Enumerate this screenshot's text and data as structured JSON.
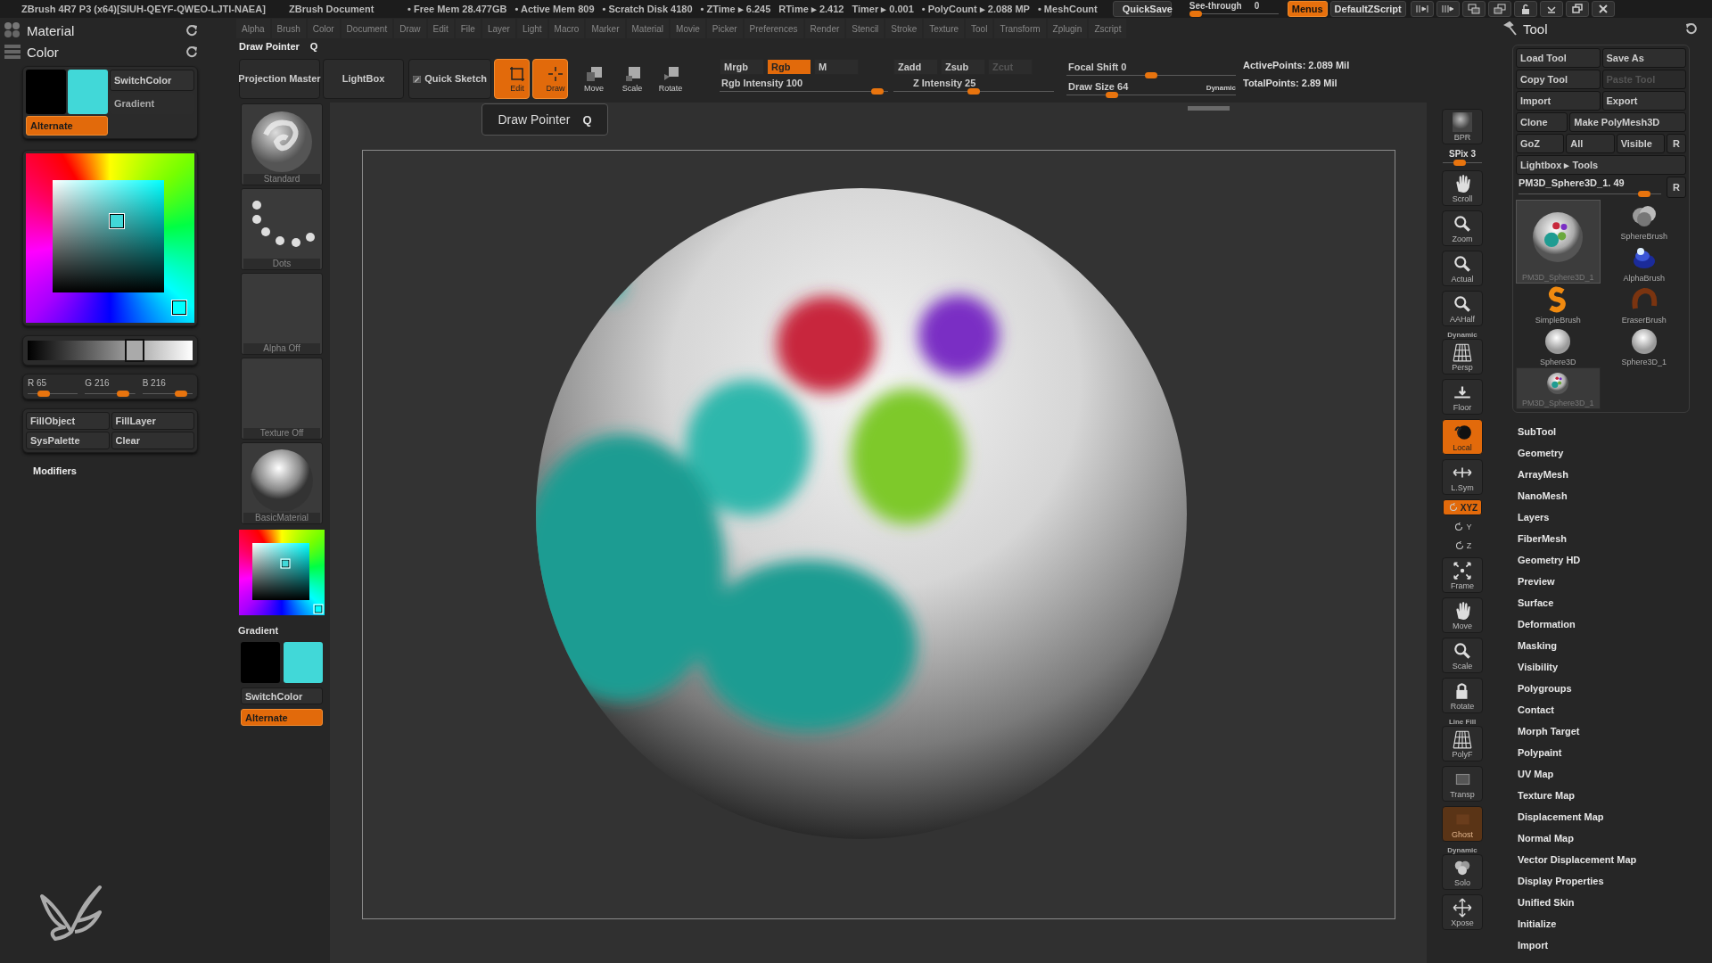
{
  "title_bar": {
    "app_title": "ZBrush 4R7 P3 (x64)[SIUH-QEYF-QWEO-LJTI-NAEA]",
    "document": "ZBrush Document",
    "stats": [
      "• Free Mem 28.477GB",
      "• Active Mem 809",
      "• Scratch Disk 4180",
      "• ZTime ▸ 6.245",
      "RTime ▸ 2.412",
      "Timer ▸ 0.001",
      "• PolyCount ▸ 2.088 MP",
      "• MeshCount"
    ],
    "quicksave": "QuickSave",
    "see_through": {
      "label": "See-through",
      "value": "0",
      "level": 0
    },
    "menus": {
      "label": "Menus",
      "on": true
    },
    "script": "DefaultZScript"
  },
  "menu_bar": [
    "Alpha",
    "Brush",
    "Color",
    "Document",
    "Draw",
    "Edit",
    "File",
    "Layer",
    "Light",
    "Macro",
    "Marker",
    "Material",
    "Movie",
    "Picker",
    "Preferences",
    "Render",
    "Stencil",
    "Stroke",
    "Texture",
    "Tool",
    "Transform",
    "Zplugin",
    "Zscript"
  ],
  "left_panel": {
    "palettes": [
      {
        "title": "Material",
        "kind": "material"
      },
      {
        "title": "Color",
        "kind": "color"
      }
    ],
    "swatches": [
      {
        "color": "#000000"
      },
      {
        "color": "#41d8d8"
      }
    ],
    "switch_color": "SwitchColor",
    "gradient": "Gradient",
    "alternate": {
      "label": "Alternate",
      "on": true
    },
    "shade": {
      "level": 0.65
    },
    "channels": [
      {
        "label": "R 65",
        "level": 0.25
      },
      {
        "label": "G 216",
        "level": 0.85
      },
      {
        "label": "B 216",
        "level": 0.85
      }
    ],
    "fill_buttons": [
      "FillObject",
      "FillLayer",
      "SysPalette",
      "Clear"
    ],
    "modifiers": "Modifiers"
  },
  "shelf": {
    "title": "Draw Pointer",
    "hotkey": "Q",
    "buttons": [
      {
        "label": "Projection Master",
        "kind": "text",
        "on": false
      },
      {
        "label": "LightBox",
        "kind": "text",
        "on": false
      },
      {
        "label": "Quick Sketch",
        "kind": "sketch",
        "on": false
      },
      {
        "label": "Edit",
        "kind": "edit",
        "on": true
      },
      {
        "label": "Draw",
        "kind": "draw",
        "on": true
      },
      {
        "label": "Move",
        "kind": "move",
        "on": false
      },
      {
        "label": "Scale",
        "kind": "scale",
        "on": false
      },
      {
        "label": "Rotate",
        "kind": "rotate",
        "on": false
      }
    ],
    "color_modes": [
      {
        "label": "Mrgb",
        "on": false
      },
      {
        "label": "Rgb",
        "on": true
      },
      {
        "label": "M",
        "on": false
      }
    ],
    "rgb_intensity": {
      "label": "Rgb Intensity 100",
      "level": 0.97
    },
    "depth_modes": [
      {
        "label": "Zadd",
        "on": false,
        "disabled": false
      },
      {
        "label": "Zsub",
        "on": false,
        "disabled": false
      },
      {
        "label": "Zcut",
        "on": false,
        "disabled": true
      }
    ],
    "z_intensity": {
      "label": "Z Intensity 25",
      "level": 0.5
    },
    "focal_shift": {
      "label": "Focal Shift 0",
      "level": 0.5
    },
    "draw_size": {
      "label": "Draw Size 64",
      "level": 0.25
    },
    "dynamic": "Dynamic",
    "points": [
      "ActivePoints: 2.089 Mil",
      "TotalPoints: 2.89 Mil"
    ]
  },
  "shelf_column": {
    "thumbnails": [
      {
        "label": "Standard",
        "kind": "brush"
      },
      {
        "label": "Dots",
        "kind": "stroke"
      },
      {
        "label": "Alpha Off",
        "kind": "alpha"
      },
      {
        "label": "Texture Off",
        "kind": "texture"
      },
      {
        "label": "BasicMaterial",
        "kind": "material"
      }
    ],
    "gradient": "Gradient",
    "swatches": [
      {
        "color": "#000000"
      },
      {
        "color": "#41d8d8"
      }
    ],
    "switch_color": "SwitchColor",
    "alternate": {
      "label": "Alternate",
      "on": true
    }
  },
  "tooltip": {
    "label": "Draw Pointer",
    "hotkey": "Q"
  },
  "right_toolbar": [
    {
      "label": "BPR",
      "kind": "button",
      "on": false
    },
    {
      "label": "SPix 3",
      "kind": "slider",
      "level": 0.4
    },
    {
      "label": "Scroll",
      "kind": "button",
      "on": false
    },
    {
      "label": "Zoom",
      "kind": "button",
      "on": false
    },
    {
      "label": "Actual",
      "kind": "button",
      "on": false
    },
    {
      "label": "AAHalf",
      "kind": "button",
      "on": false
    },
    {
      "label": "Persp",
      "caption": "Dynamic",
      "kind": "button",
      "on": false
    },
    {
      "label": "Floor",
      "kind": "button",
      "on": false
    },
    {
      "label": "Local",
      "kind": "button",
      "on": true
    },
    {
      "label": "L.Sym",
      "kind": "button",
      "on": false
    },
    {
      "label": "XYZ",
      "kind": "toggle",
      "on": true
    },
    {
      "label": "Y",
      "kind": "mini"
    },
    {
      "label": "Z",
      "kind": "mini"
    },
    {
      "label": "Frame",
      "kind": "button",
      "on": false
    },
    {
      "label": "Move",
      "kind": "button",
      "on": false
    },
    {
      "label": "Scale",
      "kind": "button",
      "on": false
    },
    {
      "label": "Rotate",
      "kind": "button",
      "on": false
    },
    {
      "label": "PolyF",
      "caption": "Line Fill",
      "kind": "button",
      "on": false
    },
    {
      "label": "Transp",
      "kind": "button",
      "on": false
    },
    {
      "label": "Ghost",
      "kind": "button",
      "disabled": true
    },
    {
      "label": "Solo",
      "caption": "Dynamic",
      "kind": "button",
      "on": false
    },
    {
      "label": "Xpose",
      "kind": "button",
      "on": false
    }
  ],
  "tool_panel": {
    "title": "Tool",
    "rows": [
      [
        {
          "label": "Load Tool",
          "disabled": false
        },
        {
          "label": "Save As",
          "disabled": false
        }
      ],
      [
        {
          "label": "Copy Tool",
          "disabled": false
        },
        {
          "label": "Paste Tool",
          "disabled": true
        }
      ],
      [
        {
          "label": "Import",
          "disabled": false
        },
        {
          "label": "Export",
          "disabled": false
        }
      ],
      [
        {
          "label": "Clone",
          "disabled": false
        },
        {
          "label": "Make PolyMesh3D",
          "disabled": false
        }
      ],
      [
        {
          "label": "GoZ",
          "disabled": false
        },
        {
          "label": "All",
          "disabled": false
        },
        {
          "label": "Visible",
          "disabled": false
        },
        {
          "label": "R",
          "disabled": false
        }
      ],
      [
        {
          "label": "Lightbox ▸ Tools",
          "disabled": false
        }
      ]
    ],
    "current": {
      "label": "PM3D_Sphere3D_1. 49",
      "level": 0.92
    },
    "reset": "R",
    "thumbnails": [
      {
        "label": "SphereBrush",
        "kind": "spherebrush",
        "selected": false
      },
      {
        "label": "PM3D_Sphere3D_1",
        "kind": "painted",
        "selected": true
      },
      {
        "label": "AlphaBrush",
        "kind": "alphabrush",
        "selected": false
      },
      {
        "label": "SimpleBrush",
        "kind": "simplebrush",
        "selected": false
      },
      {
        "label": "EraserBrush",
        "kind": "eraserbrush",
        "selected": false
      },
      {
        "label": "Sphere3D",
        "kind": "sphere",
        "selected": false
      },
      {
        "label": "Sphere3D_1",
        "kind": "sphere",
        "selected": false
      },
      {
        "label": "PM3D_Sphere3D_1",
        "kind": "painted",
        "selected": false
      }
    ],
    "subpalettes": [
      "SubTool",
      "Geometry",
      "ArrayMesh",
      "NanoMesh",
      "Layers",
      "FiberMesh",
      "Geometry HD",
      "Preview",
      "Surface",
      "Deformation",
      "Masking",
      "Visibility",
      "Polygroups",
      "Contact",
      "Morph Target",
      "Polypaint",
      "UV Map",
      "Texture Map",
      "Displacement Map",
      "Normal Map",
      "Vector Displacement Map",
      "Display Properties",
      "Unified Skin",
      "Initialize",
      "Import"
    ]
  }
}
